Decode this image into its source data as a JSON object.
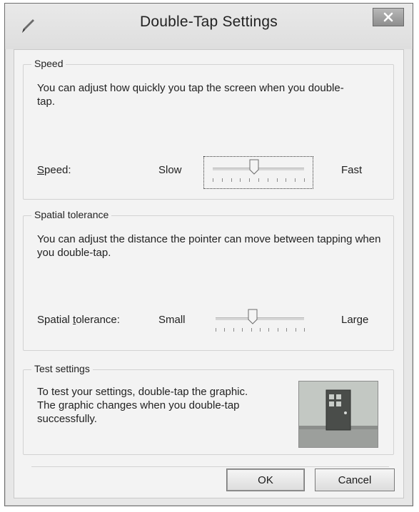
{
  "window": {
    "title": "Double-Tap Settings",
    "app_icon": "pen-icon",
    "close_icon": "close-icon"
  },
  "speed": {
    "group_title": "Speed",
    "description": "You can adjust how quickly you tap the screen when you double-tap.",
    "label_prefix": "",
    "label_mnemonic": "S",
    "label_rest": "peed:",
    "min_label": "Slow",
    "max_label": "Fast",
    "value_fraction": 0.45,
    "tick_count": 11
  },
  "spatial": {
    "group_title": "Spatial tolerance",
    "description": "You can adjust the distance the pointer can move between tapping when you double-tap.",
    "label_prefix": "Spatial ",
    "label_mnemonic": "t",
    "label_rest": "olerance:",
    "min_label": "Small",
    "max_label": "Large",
    "value_fraction": 0.42,
    "tick_count": 11
  },
  "test": {
    "group_title": "Test settings",
    "description_lines": [
      "To test your settings, double-tap the graphic.",
      "The graphic changes when you double-tap",
      "successfully."
    ],
    "graphic_icon": "door-icon"
  },
  "buttons": {
    "ok_label": "OK",
    "cancel_label": "Cancel"
  }
}
